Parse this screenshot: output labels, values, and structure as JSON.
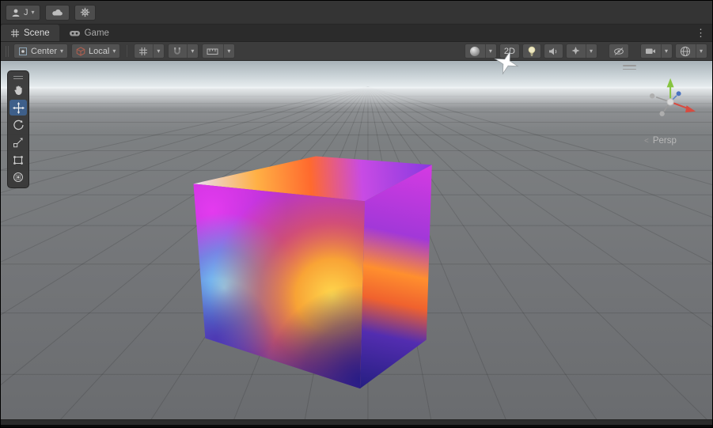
{
  "titlebar": {
    "account_initial": "J",
    "caret": "▾"
  },
  "tabs": {
    "scene_label": "Scene",
    "game_label": "Game",
    "overflow_glyph": "⋮"
  },
  "toolbar": {
    "pivot_label": "Center",
    "orientation_label": "Local",
    "mode_2d_label": "2D",
    "caret": "▾"
  },
  "scene": {
    "projection_label": "Persp",
    "projection_arrow": "<",
    "selected_tool": "move"
  },
  "icons": {
    "person-icon": "silhouette",
    "cloud-icon": "cloud",
    "gear-icon": "gear",
    "scene-grid-icon": "#-grid",
    "game-gamepad-icon": "gamepad",
    "overflow-icon": "⋮",
    "pivot-center-icon": "square-with-dot",
    "axis-local-icon": "red-cube",
    "grid-visibility-icon": "#-grid",
    "snap-magnet-icon": "magnet",
    "snap-increment-icon": "ruler",
    "shaded-mode-icon": "lit-sphere",
    "light-toggle-icon": "bulb",
    "audio-toggle-icon": "speaker",
    "effects-toggle-icon": "four-point-star",
    "visibility-toggle-icon": "eye-slash",
    "camera-select-icon": "video-camera",
    "scene-options-icon": "globe",
    "overlay-handle-icon": "double-bar",
    "hand-tool-icon": "hand",
    "move-tool-icon": "cross-arrows",
    "rotate-tool-icon": "circular-arrow",
    "scale-tool-icon": "square-diagonal-arrow",
    "rect-tool-icon": "rect-with-corners",
    "transform-tool-icon": "circle-square-dot",
    "axis-gizmo": "xyz-orientation-gizmo",
    "mouse-cursor-icon": "four-point-star-cursor"
  },
  "colors": {
    "selected_tool_bg": "#3e5f8a",
    "axis_x": "#d84b40",
    "axis_y": "#86c440",
    "axis_z": "#4a72c0",
    "sky_top": "#a8b2b8",
    "sky_horizon": "#edf2f4",
    "ground": "#737578",
    "panel_bg": "#3c3c3c",
    "tab_bg": "#2b2b2b"
  }
}
